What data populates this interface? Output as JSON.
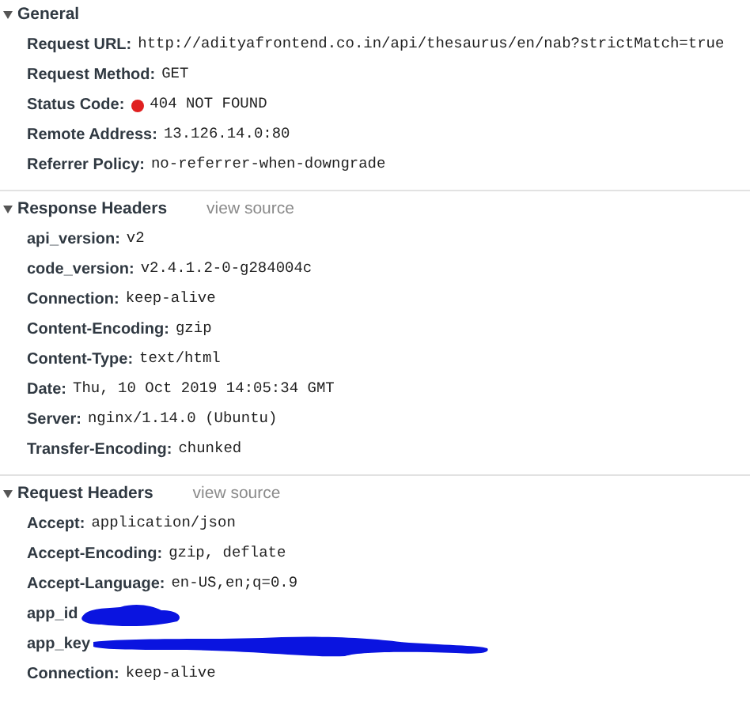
{
  "sections": [
    {
      "title": "General",
      "expanded": true,
      "rows": [
        {
          "name": "Request URL:",
          "value": "http://adityafrontend.co.in/api/thesaurus/en/nab?strictMatch=true"
        },
        {
          "name": "Request Method:",
          "value": "GET"
        },
        {
          "name": "Status Code:",
          "value": "404 NOT FOUND",
          "color": "#e02020"
        },
        {
          "name": "Remote Address:",
          "value": "13.126.14.0:80"
        },
        {
          "name": "Referrer Policy:",
          "value": "no-referrer-when-downgrade"
        }
      ]
    },
    {
      "title": "Response Headers",
      "expanded": true,
      "link": "view source",
      "rows": [
        {
          "name": "api_version:",
          "value": "v2"
        },
        {
          "name": "code_version:",
          "value": "v2.4.1.2-0-g284004c"
        },
        {
          "name": "Connection:",
          "value": "keep-alive"
        },
        {
          "name": "Content-Encoding:",
          "value": "gzip"
        },
        {
          "name": "Content-Type:",
          "value": "text/html"
        },
        {
          "name": "Date:",
          "value": "Thu, 10 Oct 2019 14:05:34 GMT"
        },
        {
          "name": "Server:",
          "value": "nginx/1.14.0 (Ubuntu)"
        },
        {
          "name": "Transfer-Encoding:",
          "value": "chunked"
        }
      ]
    },
    {
      "title": "Request Headers",
      "expanded": true,
      "link": "view source",
      "rows": [
        {
          "name": "Accept:",
          "value": "application/json"
        },
        {
          "name": "Accept-Encoding:",
          "value": "gzip, deflate"
        },
        {
          "name": "Accept-Language:",
          "value": "en-US,en;q=0.9"
        },
        {
          "name": "app_id",
          "kind": "redacted-short"
        },
        {
          "name": "app_key",
          "kind": "redacted-long"
        },
        {
          "name": "Connection:",
          "value": "keep-alive"
        }
      ]
    }
  ]
}
